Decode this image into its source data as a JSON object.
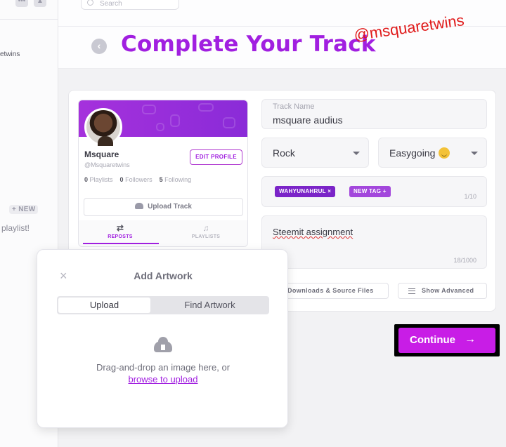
{
  "sidebar": {
    "partial_text": "etwins",
    "new_badge": "+ NEW",
    "playlist_text": "playlist!"
  },
  "search": {
    "placeholder": "Search"
  },
  "header": {
    "title": "Complete Your Track",
    "watermark": "@msquaretwins"
  },
  "profile": {
    "name": "Msquare",
    "handle": "@Msquaretwins",
    "edit_label": "EDIT PROFILE",
    "stats": [
      {
        "count": "0",
        "label": "Playlists"
      },
      {
        "count": "0",
        "label": "Followers"
      },
      {
        "count": "5",
        "label": "Following"
      }
    ],
    "upload_label": "Upload Track",
    "tabs": [
      {
        "label": "REPOSTS",
        "active": true
      },
      {
        "label": "PLAYLISTS",
        "active": false
      }
    ]
  },
  "form": {
    "track_name_label": "Track Name",
    "track_name_value": "msquare audius",
    "genre": "Rock",
    "mood": "Easygoing",
    "tags": [
      "WAHYUNAHRUL ×",
      "NEW TAG +"
    ],
    "tag_count": "1/10",
    "description": "Steemit assignment",
    "desc_count": "18/1000",
    "downloads_label": "Downloads & Source Files",
    "advanced_label": "Show Advanced",
    "continue_label": "Continue"
  },
  "modal": {
    "close": "×",
    "title": "Add Artwork",
    "tab_upload": "Upload",
    "tab_find": "Find Artwork",
    "drop_text": "Drag-and-drop an image here, or",
    "browse_text": "browse to upload"
  },
  "colors": {
    "accent": "#a11fe0",
    "continue_bg": "#c81de6",
    "watermark": "#e01b1b"
  }
}
